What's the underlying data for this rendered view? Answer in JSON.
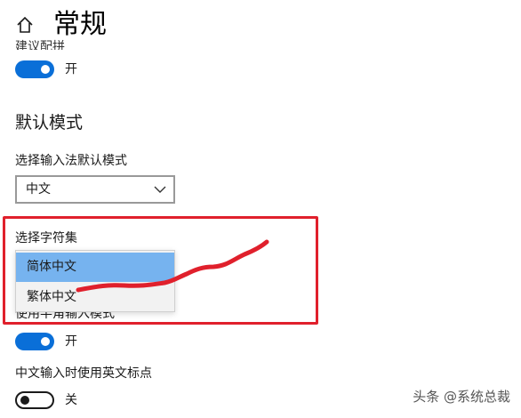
{
  "header": {
    "title": "常规",
    "home_icon": "home-icon"
  },
  "top_setting": {
    "label": "建议配拼",
    "state": "开"
  },
  "section": {
    "heading": "默认模式"
  },
  "default_mode": {
    "label": "选择输入法默认模式",
    "value": "中文",
    "chevron_icon": "chevron-down-icon"
  },
  "charset": {
    "label": "选择字符集",
    "options": [
      "简体中文",
      "繁体中文"
    ],
    "selected_index": 0
  },
  "half_width": {
    "label": "使用半角输入模式",
    "state": "开"
  },
  "english_punct": {
    "label": "中文输入时使用英文标点",
    "state": "关"
  },
  "watermark": "头条 @系统总裁",
  "colors": {
    "accent": "#0a6fd8",
    "selected_option": "#76b3ef",
    "annotation": "#e0202c"
  }
}
